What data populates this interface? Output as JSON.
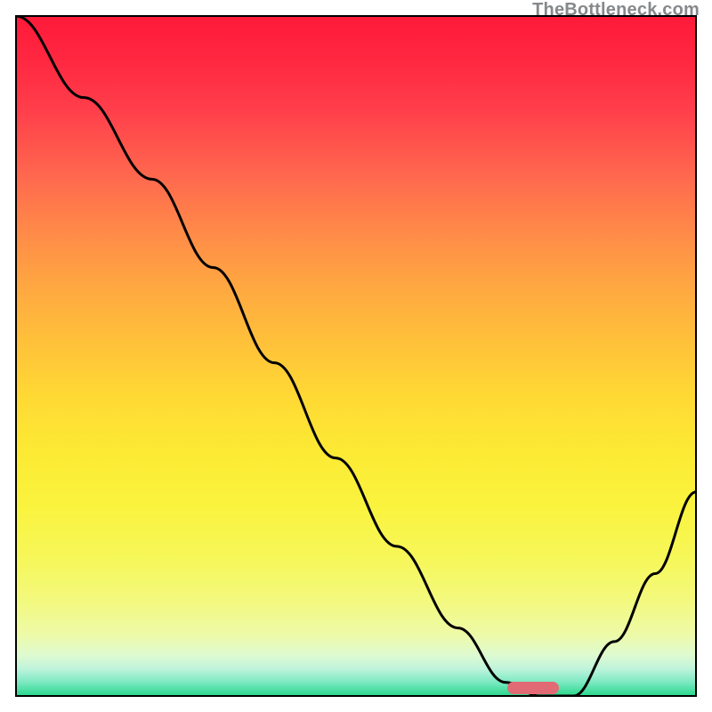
{
  "watermark": "TheBottleneck.com",
  "chart_data": {
    "type": "line",
    "title": "",
    "xlabel": "",
    "ylabel": "",
    "xlim": [
      0,
      100
    ],
    "ylim": [
      0,
      100
    ],
    "grid": false,
    "series": [
      {
        "name": "bottleneck-curve",
        "x": [
          0,
          10,
          20,
          29,
          38,
          47,
          56,
          65,
          72,
          77,
          82,
          88,
          94,
          100
        ],
        "values": [
          100,
          88,
          76,
          63,
          49,
          35,
          22,
          10,
          2,
          0,
          0,
          8,
          18,
          30
        ]
      }
    ],
    "annotations": [
      {
        "name": "optimal-marker",
        "shape": "pill",
        "x_center": 78,
        "y": 0,
        "color": "#e26a74"
      }
    ],
    "background_gradient": {
      "stops": [
        {
          "pct": 0,
          "color": "#ff1a3a"
        },
        {
          "pct": 50,
          "color": "#ffc13a"
        },
        {
          "pct": 85,
          "color": "#f4f86c"
        },
        {
          "pct": 100,
          "color": "#27d78a"
        }
      ]
    }
  }
}
